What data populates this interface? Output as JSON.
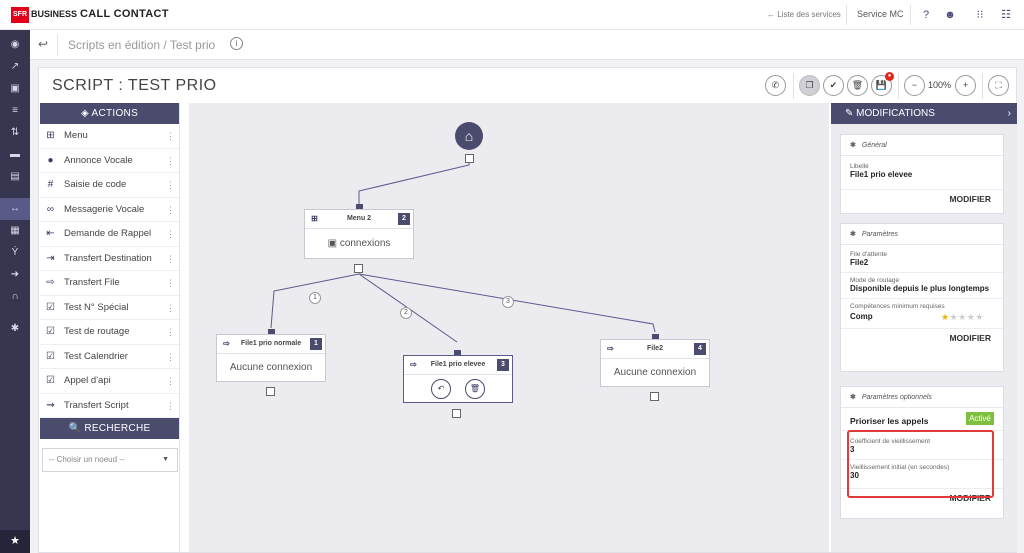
{
  "topbar": {
    "logo": "SFR",
    "logo_suffix": "BUSINESS",
    "app_title": "CALL CONTACT",
    "services_link": "← Liste des services",
    "service_name": "Service MC",
    "icons": [
      "help-icon",
      "users-icon",
      "apps-grid-icon",
      "menu-grid-icon"
    ]
  },
  "leftnav": {
    "items": [
      {
        "icon": "eye-icon",
        "glyph": "◉"
      },
      {
        "icon": "trend-icon",
        "glyph": "↗"
      },
      {
        "icon": "lock-icon",
        "glyph": "▣"
      },
      {
        "icon": "list-icon",
        "glyph": "≡"
      },
      {
        "icon": "transfer-icon",
        "glyph": "⇅"
      },
      {
        "icon": "chat-icon",
        "glyph": "▬"
      },
      {
        "icon": "folder-icon",
        "glyph": "▤"
      },
      {
        "icon": "code-icon",
        "glyph": "↔"
      },
      {
        "icon": "calendar-icon",
        "glyph": "▦"
      },
      {
        "icon": "fork-icon",
        "glyph": "Ý"
      },
      {
        "icon": "forward-icon",
        "glyph": "➜"
      },
      {
        "icon": "headset-icon",
        "glyph": "∩"
      },
      {
        "icon": "gear-icon",
        "glyph": "✱"
      }
    ],
    "star": "★"
  },
  "breadcrumb": {
    "back": "↩",
    "text": "Scripts en édition / Test prio",
    "info": "i"
  },
  "script": {
    "title": "SCRIPT : TEST PRIO",
    "zoom": "100%",
    "toolbar": {
      "phone": "✆",
      "copy": "❐",
      "validate": "✔",
      "delete": "🗑",
      "save": "💾",
      "save_badge": "●",
      "zoom_out": "−",
      "zoom_in": "+",
      "fullscreen": "⛶"
    }
  },
  "actions": {
    "header": "ACTIONS",
    "items": [
      {
        "label": "Menu",
        "glyph": "⊞"
      },
      {
        "label": "Annonce Vocale",
        "glyph": "●"
      },
      {
        "label": "Saisie de code",
        "glyph": "#"
      },
      {
        "label": "Messagerie Vocale",
        "glyph": "∞"
      },
      {
        "label": "Demande de Rappel",
        "glyph": "⇤"
      },
      {
        "label": "Transfert Destination",
        "glyph": "⇥"
      },
      {
        "label": "Transfert File",
        "glyph": "⇨"
      },
      {
        "label": "Test N° Spécial",
        "glyph": "☑"
      },
      {
        "label": "Test de routage",
        "glyph": "☑"
      },
      {
        "label": "Test Calendrier",
        "glyph": "☑"
      },
      {
        "label": "Appel d'api",
        "glyph": "☑"
      },
      {
        "label": "Transfert Script",
        "glyph": "⇝"
      }
    ],
    "dots": "⋮",
    "search_header": "RECHERCHE",
    "select_placeholder": "-- Choisir un noeud --",
    "select_caret": "▼"
  },
  "canvas": {
    "home_glyph": "⌂",
    "nodes": [
      {
        "title": "Menu 2",
        "num": "2",
        "body": "connexions",
        "glyph": "⊞"
      },
      {
        "title": "File1 prio normale",
        "num": "1",
        "body": "Aucune connexion",
        "glyph": "⇨"
      },
      {
        "title": "File1 prio elevee",
        "num": "3",
        "glyph": "⇨",
        "btn1": "↶",
        "btn2": "🗑"
      },
      {
        "title": "File2",
        "num": "4",
        "body": "Aucune connexion",
        "glyph": "⇨"
      }
    ],
    "branches": [
      "1",
      "2",
      "3"
    ]
  },
  "modifications": {
    "header": "MODIFICATIONS",
    "chevron": "›",
    "general": {
      "title": "Général",
      "label": "Libellé",
      "value": "File1 prio elevee",
      "button": "MODIFIER"
    },
    "parametres": {
      "title": "Paramètres",
      "file_label": "File d'attente",
      "file_value": "File2",
      "routage_label": "Mode de routage",
      "routage_value": "Disponible depuis le plus longtemps",
      "comp_label": "Compétences minimum requises",
      "comp_value": "Comp",
      "rating": 1,
      "rating_max": 5,
      "button": "MODIFIER"
    },
    "optionnels": {
      "title": "Paramètres optionnels",
      "prioriser_label": "Prioriser les appels",
      "prioriser_status": "Activé",
      "coef_label": "Coefficient de vieillissement",
      "coef_value": "3",
      "vieil_label": "Vieillissement initial (en secondes)",
      "vieil_value": "30",
      "button": "MODIFIER"
    }
  },
  "colors": {
    "accent": "#4b4b6e",
    "nav_bg": "#363650",
    "brand_red": "#e2001a",
    "active_green": "#7fbf3f",
    "highlight_red": "#e03a3a"
  }
}
